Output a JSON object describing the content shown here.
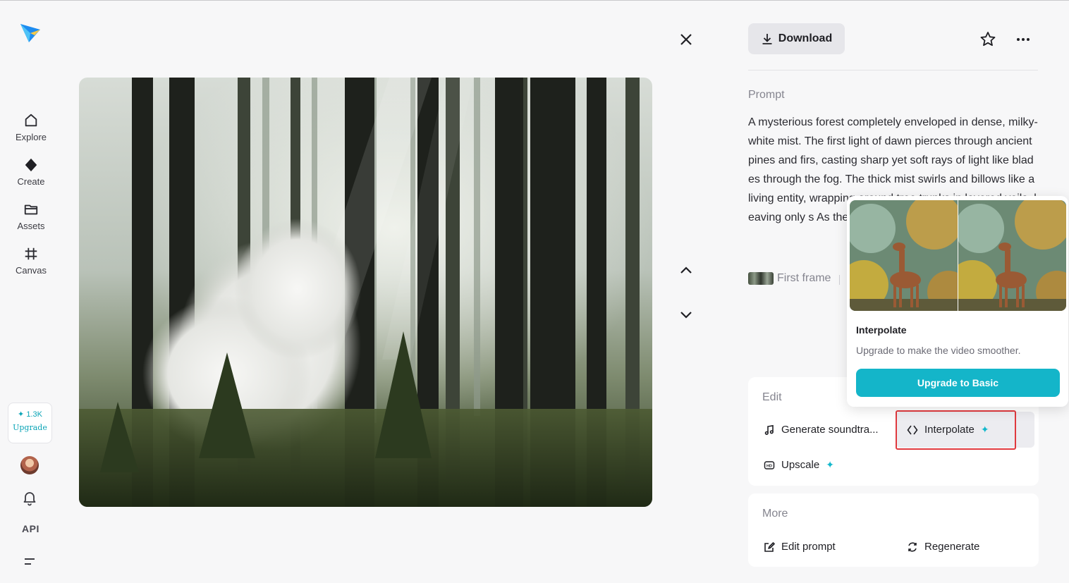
{
  "sidebar": {
    "items": [
      {
        "label": "Explore",
        "icon": "home-icon"
      },
      {
        "label": "Create",
        "icon": "diamond-icon"
      },
      {
        "label": "Assets",
        "icon": "folder-icon"
      },
      {
        "label": "Canvas",
        "icon": "grid-frame-icon"
      }
    ],
    "credits": "1.3K",
    "upgrade_label": "Upgrade",
    "api_label": "API"
  },
  "viewer": {
    "media_description_icon": "forest-video-frame"
  },
  "panel": {
    "download_label": "Download",
    "prompt_title": "Prompt",
    "prompt_text": "A mysterious forest completely enveloped in dense, milky-white mist. The first light of dawn pierces through ancient pines and firs, casting sharp yet soft rays of light like blades through the fog. The thick mist swirls and billows like a living entity, wrapping around tree trunks in layered veils, leaving only s As the camera slow with the wind, while",
    "first_frame_label": "First frame",
    "edit": {
      "title": "Edit",
      "generate_soundtrack": "Generate soundtra...",
      "interpolate": "Interpolate",
      "upscale": "Upscale"
    },
    "more": {
      "title": "More",
      "edit_prompt": "Edit prompt",
      "regenerate": "Regenerate"
    }
  },
  "popover": {
    "title": "Interpolate",
    "description": "Upgrade to make the video smoother.",
    "button": "Upgrade to Basic"
  },
  "colors": {
    "accent": "#14b5c9",
    "highlight": "#e0393e"
  }
}
